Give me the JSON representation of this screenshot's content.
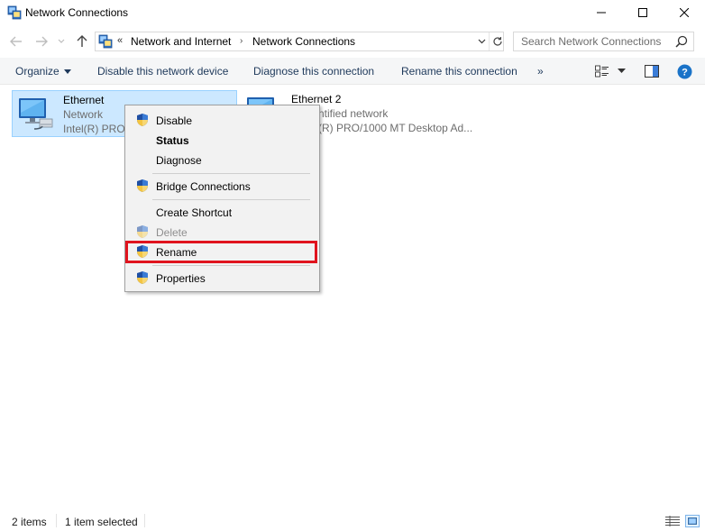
{
  "window": {
    "title": "Network Connections"
  },
  "address": {
    "overflow": "«",
    "crumbs": [
      "Network and Internet",
      "Network Connections"
    ],
    "search_placeholder": "Search Network Connections"
  },
  "toolbar": {
    "organize": "Organize",
    "disable_device": "Disable this network device",
    "diagnose": "Diagnose this connection",
    "rename": "Rename this connection",
    "more": "»"
  },
  "items": [
    {
      "name": "Ethernet",
      "status": "Network",
      "adapter": "Intel(R) PRO/"
    },
    {
      "name": "Ethernet 2",
      "status": "ntified network",
      "adapter": "(R) PRO/1000 MT Desktop Ad..."
    }
  ],
  "context_menu": {
    "disable": "Disable",
    "status": "Status",
    "diagnose": "Diagnose",
    "bridge": "Bridge Connections",
    "shortcut": "Create Shortcut",
    "delete": "Delete",
    "rename": "Rename",
    "properties": "Properties"
  },
  "statusbar": {
    "count": "2 items",
    "selection": "1 item selected"
  },
  "colors": {
    "selection_bg": "#cce8ff",
    "selection_border": "#99d1ff",
    "highlight_box": "#e0141e",
    "command_text": "#1e395b",
    "help_icon": "#1a73c8"
  },
  "icons": {
    "app": "network-connections-icon",
    "shield": "uac-shield-icon",
    "help": "help-icon"
  }
}
